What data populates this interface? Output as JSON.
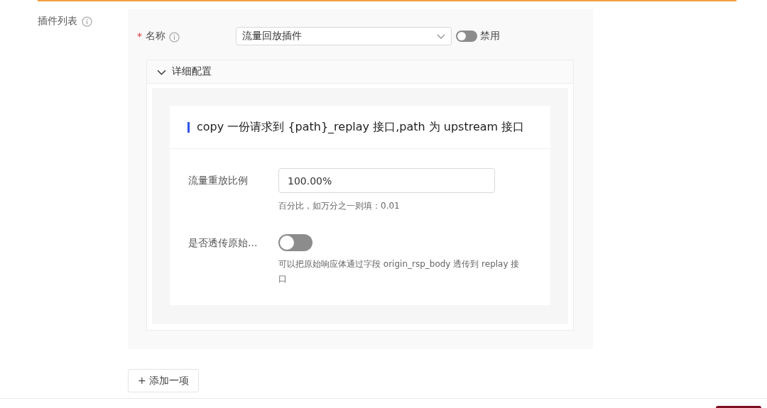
{
  "plugin_list": {
    "label": "插件列表"
  },
  "plugin": {
    "name_label": "名称",
    "required_mark": "*",
    "selected_value": "流量回放插件",
    "status_toggle": {
      "on": false,
      "label": "禁用"
    },
    "details": {
      "title": "详细配置",
      "expanded": true,
      "section_title": "copy 一份请求到 {path}_replay 接口,path 为 upstream 接口",
      "fields": [
        {
          "kind": "input",
          "label": "流量重放比例",
          "value": "100.00%",
          "help": "百分比，如万分之一则填：0.01"
        },
        {
          "kind": "switch",
          "label": "是否透传原始...",
          "on": false,
          "help": "可以把原始响应体通过字段 origin_rsp_body 透传到 replay 接口"
        }
      ]
    }
  },
  "add_button": {
    "label": "+ 添加一项"
  }
}
